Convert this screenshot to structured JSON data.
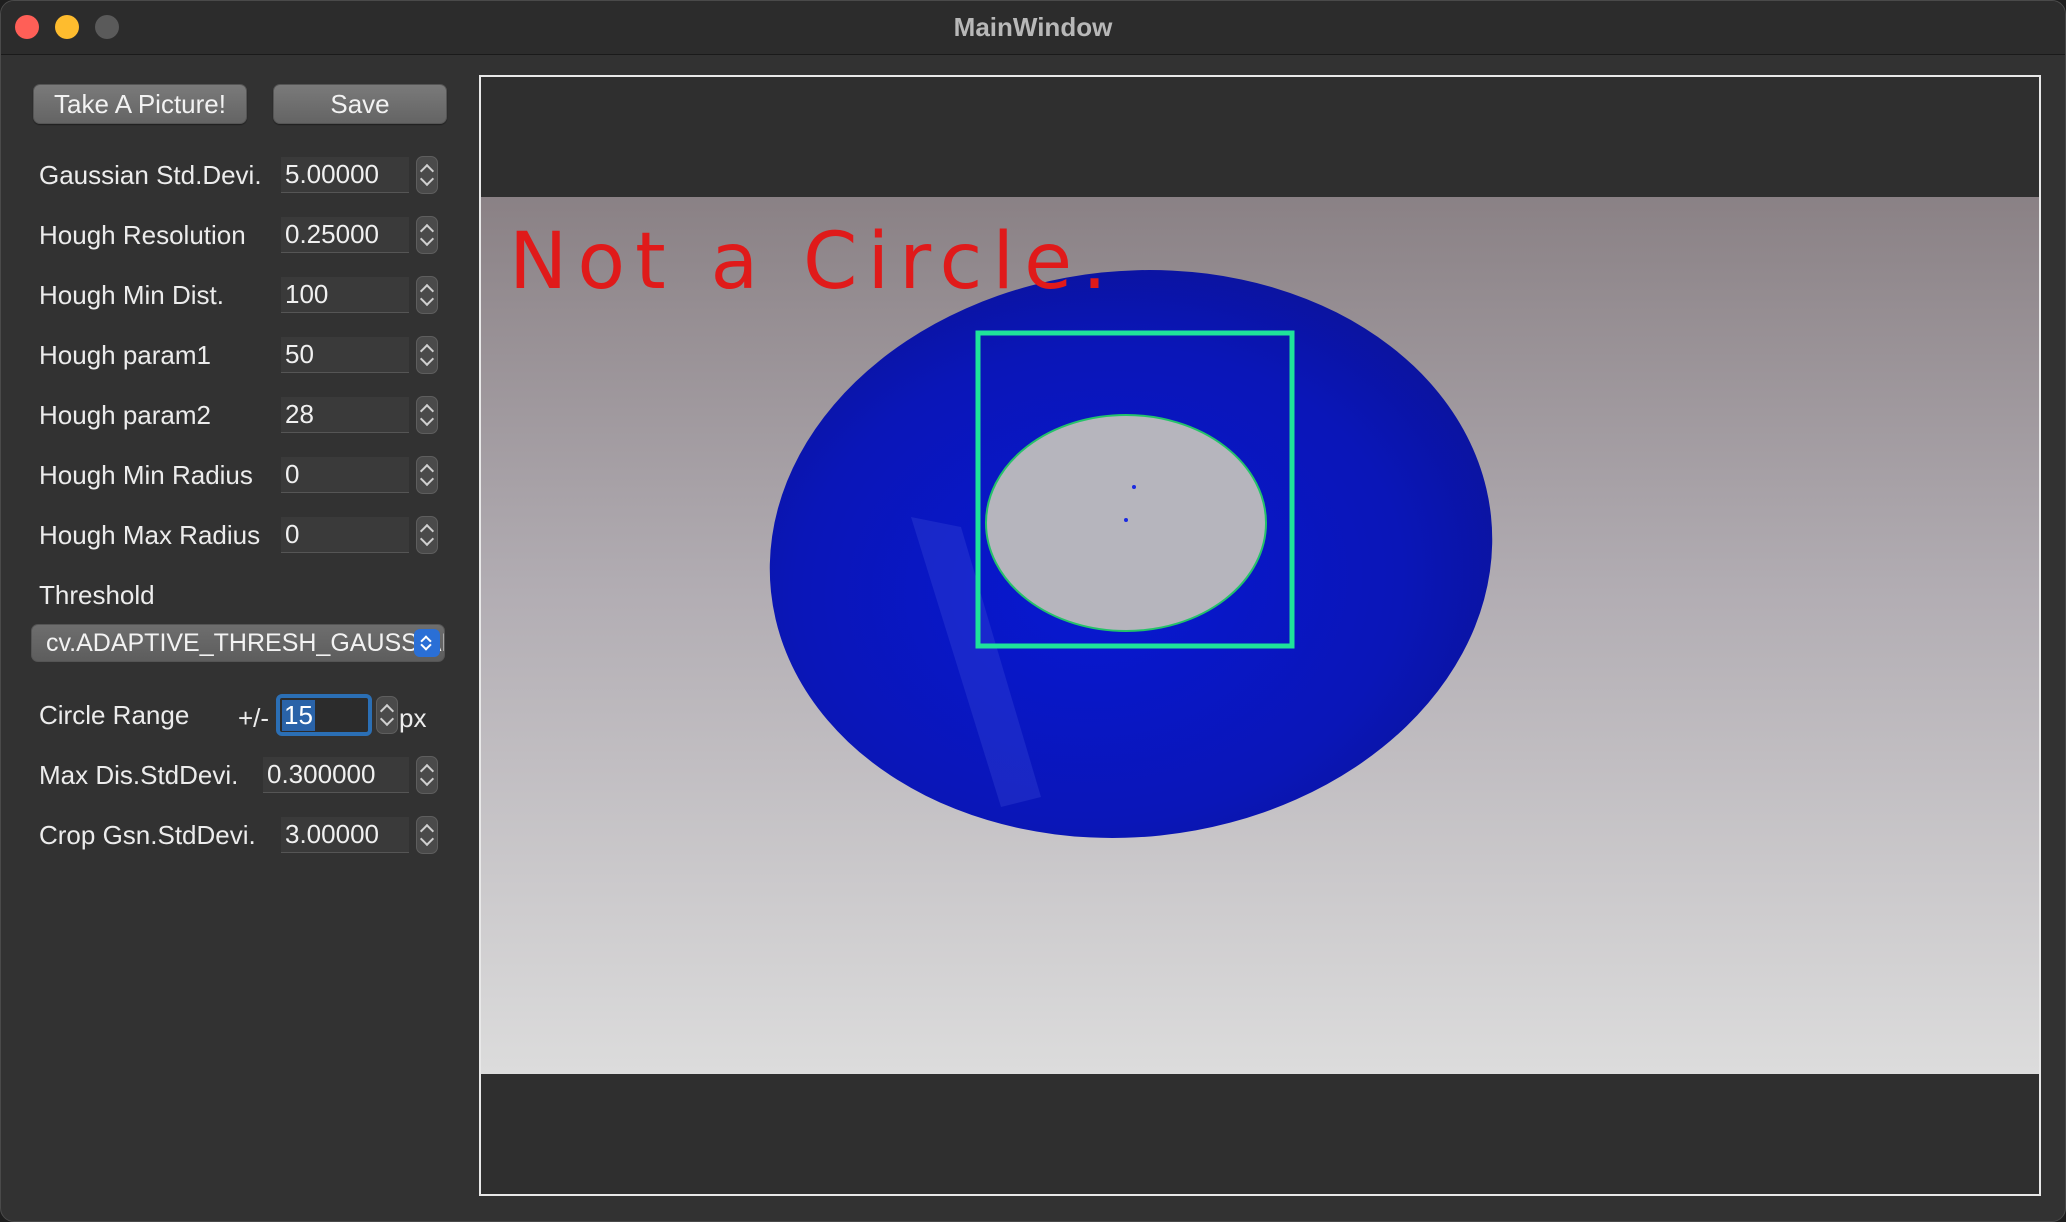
{
  "window": {
    "title": "MainWindow"
  },
  "toolbar": {
    "take_picture_label": "Take A Picture!",
    "save_label": "Save"
  },
  "params": [
    {
      "label": "Gaussian Std.Devi.",
      "value": "5.00000"
    },
    {
      "label": "Hough Resolution",
      "value": "0.25000"
    },
    {
      "label": "Hough Min Dist.",
      "value": "100"
    },
    {
      "label": "Hough param1",
      "value": "50"
    },
    {
      "label": "Hough param2",
      "value": "28"
    },
    {
      "label": "Hough Min Radius",
      "value": "0"
    },
    {
      "label": "Hough Max Radius",
      "value": "0"
    }
  ],
  "threshold": {
    "label": "Threshold",
    "selected": "cv.ADAPTIVE_THRESH_GAUSSIAN_C"
  },
  "circle_range": {
    "label": "Circle Range",
    "prefix": "+/-",
    "value": "15",
    "unit": "px"
  },
  "extra_params": [
    {
      "label": "Max Dis.StdDevi.",
      "value": "0.300000"
    },
    {
      "label": "Crop Gsn.StdDevi.",
      "value": "3.00000"
    }
  ],
  "viewer": {
    "overlay_text": "Not a Circle."
  },
  "colors": {
    "accent": "#2b6fb5",
    "overlay_text": "#e01a1a",
    "detection_box": "#1fe39a",
    "disc": "#0a18c8"
  }
}
